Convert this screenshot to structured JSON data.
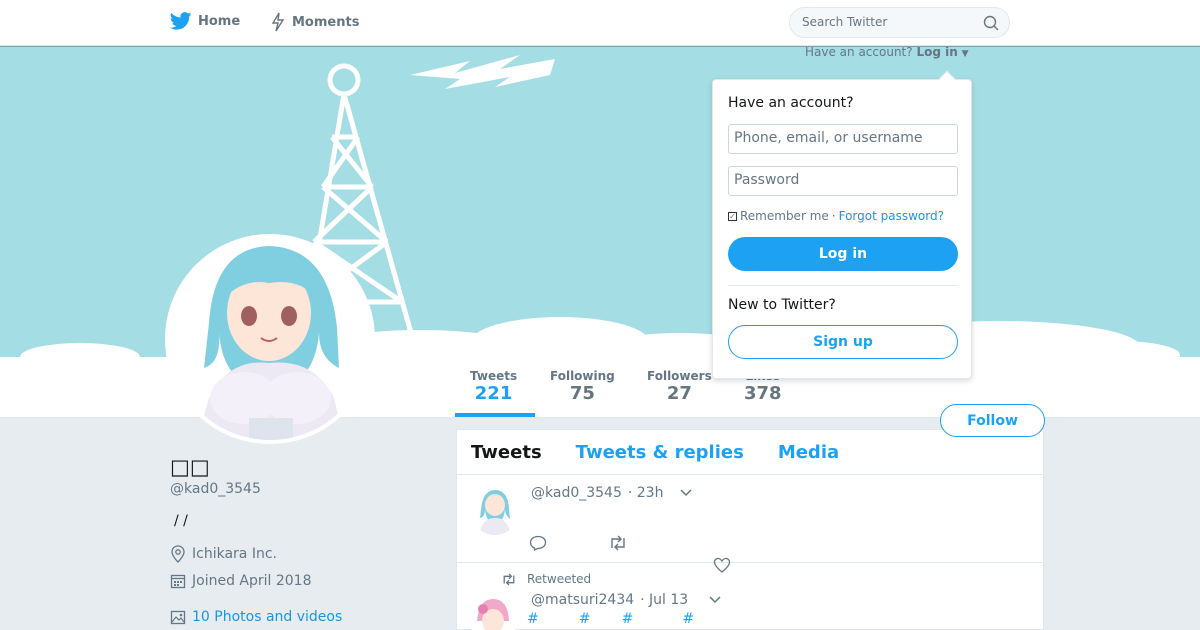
{
  "nav": {
    "home_label": "Home",
    "moments_label": "Moments",
    "search_placeholder": "Search Twitter"
  },
  "banner": {
    "have_account_text": "Have an account?",
    "login_link": "Log in"
  },
  "login_dropdown": {
    "heading": "Have an account?",
    "username_placeholder": "Phone, email, or username",
    "password_placeholder": "Password",
    "remember_me": "Remember me",
    "separator": "·",
    "forgot_password": "Forgot password?",
    "login_button": "Log in",
    "new_to_twitter": "New to Twitter?",
    "signup_button": "Sign up"
  },
  "stats": [
    {
      "label": "Tweets",
      "value": "221",
      "active": true
    },
    {
      "label": "Following",
      "value": "75",
      "active": false
    },
    {
      "label": "Followers",
      "value": "27",
      "active": false
    },
    {
      "label": "Likes",
      "value": "378",
      "active": false
    }
  ],
  "follow_button": "Follow",
  "profile": {
    "name": "□□",
    "handle": "@kad0_3545",
    "bio": "/ /",
    "location": "Ichikara Inc.",
    "joined": "Joined April 2018",
    "media_link": "10 Photos and videos"
  },
  "timeline": {
    "tabs": [
      {
        "label": "Tweets",
        "active": true
      },
      {
        "label": "Tweets & replies",
        "active": false
      },
      {
        "label": "Media",
        "active": false
      }
    ],
    "tweets": [
      {
        "handle": "@kad0_3545",
        "time": "· 23h"
      },
      {
        "retweeted_label": "Retweeted",
        "handle": "@matsuri2434",
        "time": "· Jul 13",
        "text": "#         #       #           #"
      }
    ]
  },
  "colors": {
    "accent": "#1da1f2",
    "banner": "#a5dde4",
    "background": "#e6ecf0"
  }
}
